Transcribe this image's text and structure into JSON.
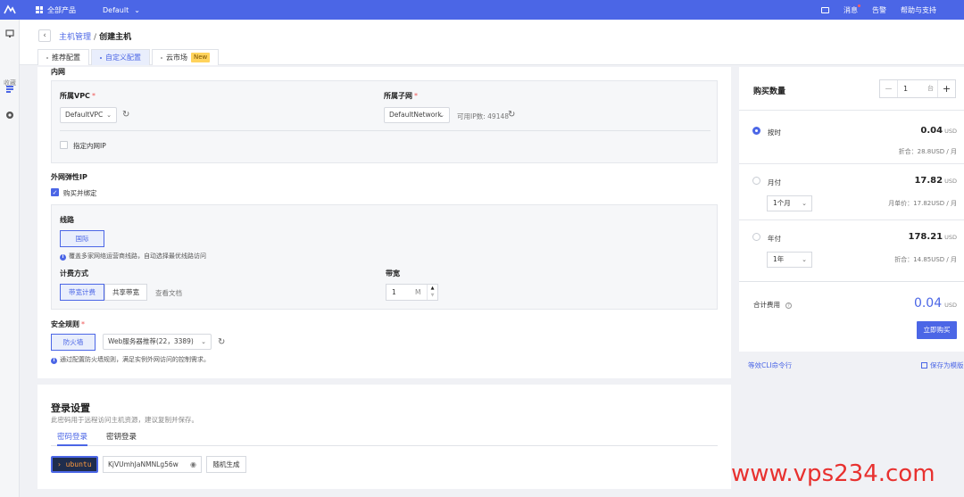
{
  "topbar": {
    "products_label": "全部产品",
    "project_label": "Default",
    "messages_label": "消息",
    "alerts_label": "告警",
    "help_label": "帮助与支持"
  },
  "sidebar": {
    "favorites_label": "收藏"
  },
  "breadcrumb": {
    "parent": "主机管理",
    "separator": "/",
    "current": "创建主机"
  },
  "tabs": [
    {
      "label": "推荐配置"
    },
    {
      "label": "自定义配置"
    },
    {
      "label": "云市场",
      "badge": "New"
    }
  ],
  "intranet": {
    "title": "内网",
    "vpc_label": "所属VPC",
    "vpc_value": "DefaultVPC",
    "subnet_label": "所属子网",
    "subnet_value": "DefaultNetwork",
    "available_ips": "可用IP数: 49148",
    "specify_ip_label": "指定内网IP"
  },
  "eip": {
    "title": "外网弹性IP",
    "bind_label": "购买并绑定",
    "line_label": "线路",
    "line_option": "国际",
    "line_hint": "覆盖多家网络运营商线路，自动选择最优线路访问",
    "billing_label": "计费方式",
    "billing_options": [
      "带宽计费",
      "共享带宽"
    ],
    "docs_link": "查看文档",
    "bandwidth_label": "带宽",
    "bandwidth_value": "1",
    "bandwidth_unit": "M",
    "spin_up": "▲",
    "spin_down": "▼"
  },
  "security": {
    "title": "安全规则",
    "firewall_label": "防火墙",
    "rule_value": "Web服务器推荐(22，3389)",
    "hint": "通过配置防火墙规则，满足实例外网访问的控制需求。"
  },
  "login": {
    "title": "登录设置",
    "subtitle": "此密码用于远程访问主机资源，建议复制并保存。",
    "tabs": [
      "密码登录",
      "密钥登录"
    ],
    "username": "› ubuntu",
    "password": "KjVUmhJaNMNLg56w",
    "generate_label": "随机生成"
  },
  "purchase": {
    "quantity_label": "购买数量",
    "quantity_value": "1",
    "quantity_unit": "台",
    "plans": [
      {
        "label": "按时",
        "price": "0.04",
        "currency": "USD",
        "sub": "折合：28.8USD / 月"
      },
      {
        "label": "月付",
        "price": "17.82",
        "currency": "USD",
        "select": "1个月",
        "sub": "月单价：17.82USD / 月"
      },
      {
        "label": "年付",
        "price": "178.21",
        "currency": "USD",
        "select": "1年",
        "sub": "折合：14.85USD / 月"
      }
    ],
    "total_label": "合计费用",
    "total_price": "0.04",
    "total_currency": "USD",
    "buy_label": "立即购买",
    "cli_link": "等效CLI命令行",
    "save_template_link": "保存为模版"
  },
  "watermark": "www.vps234.com",
  "colors": {
    "primary": "#4b66e6",
    "background": "#f0f1f5",
    "new_badge": "#ffd35c",
    "watermark": "#e8312f"
  }
}
